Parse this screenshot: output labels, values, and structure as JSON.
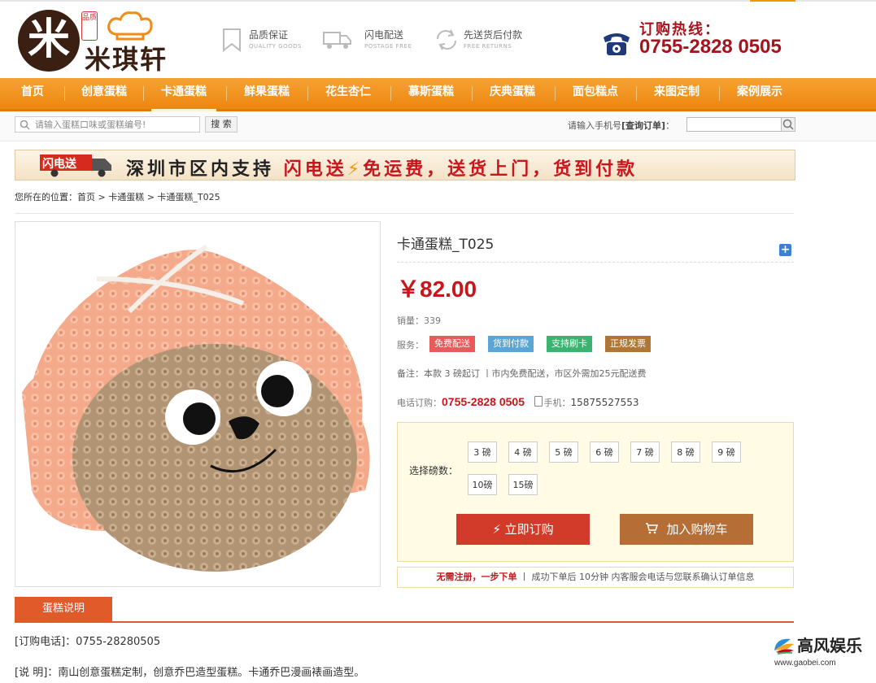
{
  "header": {
    "brand": "米琪轩",
    "seal": "品质",
    "features": [
      {
        "title": "品质保证",
        "sub": "QUALITY GOODS",
        "icon": "bookmark-icon"
      },
      {
        "title": "闪电配送",
        "sub": "POSTAGE FREE",
        "icon": "truck-icon"
      },
      {
        "title": "先送货后付款",
        "sub": "FREE RETURNS",
        "icon": "returns-icon"
      }
    ],
    "hotline_label": "订购热线：",
    "hotline_number": "0755-2828 0505"
  },
  "nav": {
    "items": [
      "首页",
      "创意蛋糕",
      "卡通蛋糕",
      "鲜果蛋糕",
      "花生杏仁",
      "慕斯蛋糕",
      "庆典蛋糕",
      "面包糕点",
      "来图定制",
      "案例展示"
    ],
    "active_index": 2
  },
  "search": {
    "placeholder": "请输入蛋糕口味或蛋糕编号!",
    "button": "搜 索",
    "order_query_prefix": "请输入手机号",
    "order_query_bold": "[查询订单]",
    "order_query_suffix": "："
  },
  "banner": {
    "tag": "闪电送",
    "text_a": "深圳市区内支持",
    "text_b": "闪电送",
    "bolt": "⚡",
    "text_c": "免运费，送货上门，货到付款"
  },
  "breadcrumb": "您所在的位置：首页 > 卡通蛋糕 > 卡通蛋糕_T025",
  "product": {
    "title": "卡通蛋糕_T025",
    "price": "￥82.00",
    "sales": "销量：339",
    "service_label": "服务：",
    "services": [
      {
        "label": "免费配送",
        "color": "#e85b5b"
      },
      {
        "label": "货到付款",
        "color": "#5aa6d6"
      },
      {
        "label": "支持刷卡",
        "color": "#3cb371"
      },
      {
        "label": "正规发票",
        "color": "#b07636"
      }
    ],
    "note": "备注：本款 3 磅起订 丨市内免费配送，市区外需加25元配送费",
    "tel_label": "电话订购：",
    "tel_number": "0755-2828 0505",
    "mobile_label": "手机：",
    "mobile_number": "15875527553",
    "weight_label": "选择磅数：",
    "weights": [
      "3 磅",
      "4 磅",
      "5 磅",
      "6 磅",
      "7 磅",
      "8 磅",
      "9 磅",
      "10磅",
      "15磅"
    ],
    "buy_now": "立即订购",
    "add_cart": "加入购物车",
    "strip_a": "无需注册，一步下单",
    "strip_b": "丨 成功下单后 10分钟 内客服会电话与您联系确认订单信息"
  },
  "description": {
    "tab": "蛋糕说明",
    "line1": "[订购电话]：0755-28280505",
    "line2": "[说 明]：南山创意蛋糕定制，创意乔巴造型蛋糕。卡通乔巴漫画裱画造型。"
  },
  "watermark": {
    "title": "高风娱乐",
    "url": "www.gaobei.com"
  },
  "colors": {
    "accent": "#f08c1a",
    "price": "#c8161d",
    "buy": "#d23a2a",
    "cart": "#b46e36",
    "brand": "#3a1f12"
  }
}
